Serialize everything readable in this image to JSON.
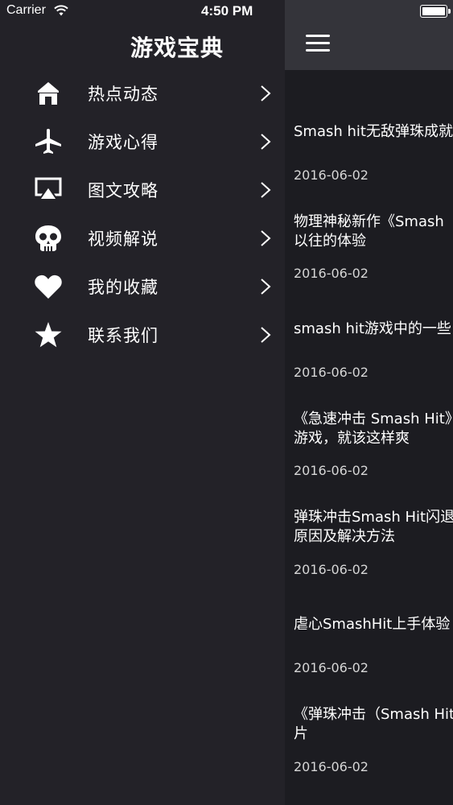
{
  "status_bar": {
    "carrier": "Carrier",
    "time": "4:50 PM"
  },
  "drawer": {
    "title": "游戏宝典",
    "items": [
      {
        "label": "热点动态",
        "icon": "home-icon"
      },
      {
        "label": "游戏心得",
        "icon": "airplane-icon"
      },
      {
        "label": "图文攻略",
        "icon": "airplay-icon"
      },
      {
        "label": "视频解说",
        "icon": "skull-icon"
      },
      {
        "label": "我的收藏",
        "icon": "heart-icon"
      },
      {
        "label": "联系我们",
        "icon": "star-icon"
      }
    ]
  },
  "articles": [
    {
      "title": "Smash hit无敌弹珠成就",
      "date": "2016-06-02"
    },
    {
      "title": "物理神秘新作《Smash\n以往的体验",
      "date": "2016-06-02"
    },
    {
      "title": "smash hit游戏中的一些",
      "date": "2016-06-02"
    },
    {
      "title": "《急速冲击 Smash Hit》\n游戏，就该这样爽",
      "date": "2016-06-02"
    },
    {
      "title": "弹珠冲击Smash Hit闪退\n原因及解决方法",
      "date": "2016-06-02"
    },
    {
      "title": "虐心SmashHit上手体验",
      "date": "2016-06-02"
    },
    {
      "title": "《弹珠冲击（Smash Hit\n片",
      "date": "2016-06-02"
    }
  ],
  "colors": {
    "drawer_bg": "#232228",
    "panel_bg": "#1c1c21",
    "header_bg": "#34343a",
    "text": "#ffffff"
  }
}
